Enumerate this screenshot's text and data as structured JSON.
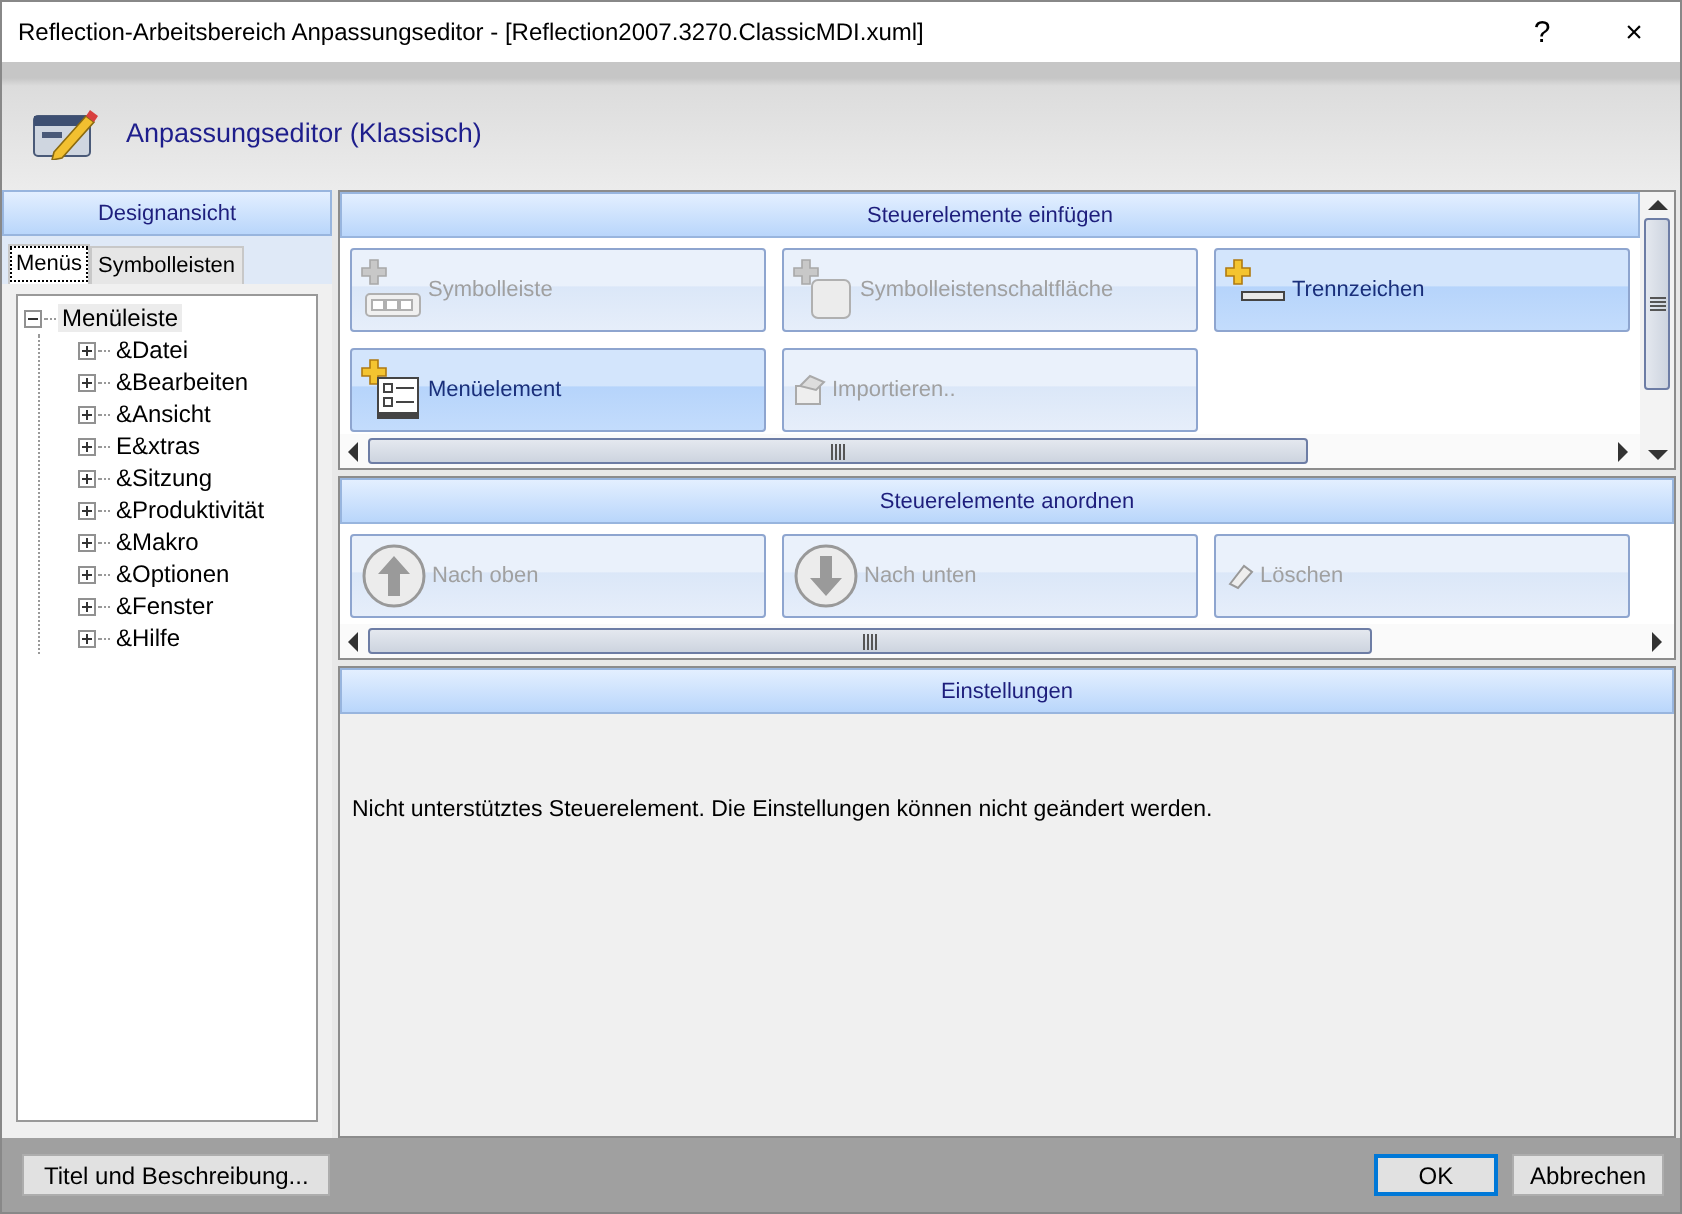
{
  "window": {
    "title": "Reflection-Arbeitsbereich Anpassungseditor - [Reflection2007.3270.ClassicMDI.xuml]",
    "help": "?",
    "close": "×"
  },
  "header": {
    "title": "Anpassungseditor (Klassisch)"
  },
  "design_view": {
    "title": "Designansicht",
    "tabs": [
      {
        "label": "Menüs",
        "selected": true
      },
      {
        "label": "Symbolleisten",
        "selected": false
      }
    ],
    "tree": [
      {
        "label": "Menüleiste",
        "expanded": true,
        "selected": true,
        "children": [
          {
            "label": "&Datei",
            "expanded": false,
            "selected": false
          },
          {
            "label": "&Bearbeiten",
            "expanded": false,
            "selected": false
          },
          {
            "label": "&Ansicht",
            "expanded": false,
            "selected": false
          },
          {
            "label": "E&xtras",
            "expanded": false,
            "selected": false
          },
          {
            "label": "&Sitzung",
            "expanded": false,
            "selected": false
          },
          {
            "label": "&Produktivität",
            "expanded": false,
            "selected": false
          },
          {
            "label": "&Makro",
            "expanded": false,
            "selected": false
          },
          {
            "label": "&Optionen",
            "expanded": false,
            "selected": false
          },
          {
            "label": "&Fenster",
            "expanded": false,
            "selected": false
          },
          {
            "label": "&Hilfe",
            "expanded": false,
            "selected": false
          }
        ]
      }
    ]
  },
  "insert_controls": {
    "title": "Steuerelemente einfügen",
    "buttons": [
      {
        "label": "Symbolleiste",
        "kind": "toolbar",
        "disabled": true
      },
      {
        "label": "Symbolleistenschaltfläche",
        "kind": "toolbar-button",
        "disabled": true
      },
      {
        "label": "Trennzeichen",
        "kind": "separator",
        "disabled": false
      },
      {
        "label": "Menüelement",
        "kind": "menu-item",
        "disabled": false
      },
      {
        "label": "Importieren..",
        "kind": "import",
        "disabled": true
      }
    ]
  },
  "arrange_controls": {
    "title": "Steuerelemente anordnen",
    "buttons": [
      {
        "label": "Nach oben",
        "kind": "up",
        "disabled": true
      },
      {
        "label": "Nach unten",
        "kind": "down",
        "disabled": true
      },
      {
        "label": "Löschen",
        "kind": "eraser",
        "disabled": true
      }
    ]
  },
  "settings": {
    "title": "Einstellungen",
    "message": "Nicht unterstütztes Steuerelement. Die Einstellungen können nicht geändert werden."
  },
  "footer": {
    "left_button": {
      "label": "Titel und Beschreibung..."
    },
    "buttons": [
      {
        "label": "OK",
        "default": true
      },
      {
        "label": "Abbrechen",
        "default": false
      }
    ]
  }
}
